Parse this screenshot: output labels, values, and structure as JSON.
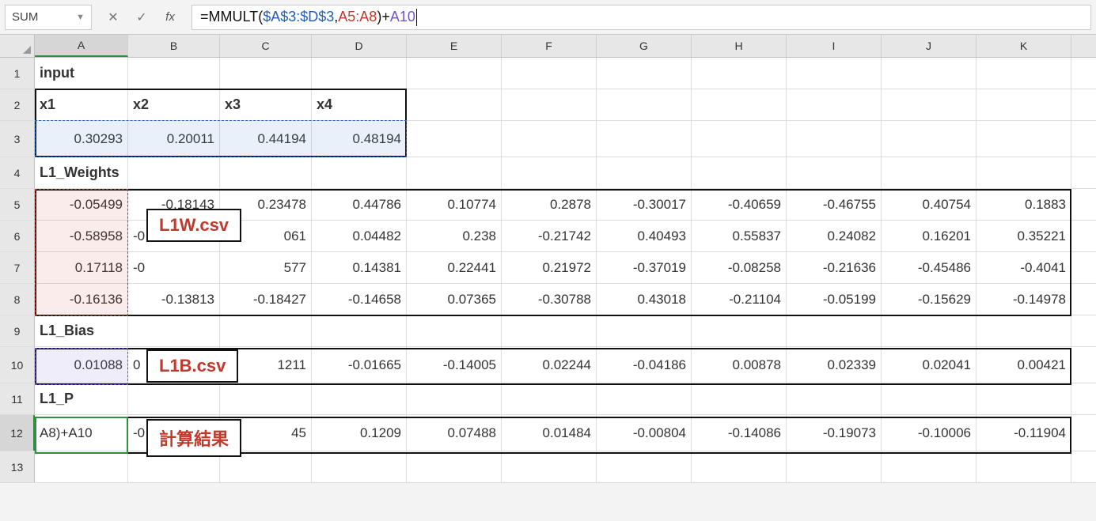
{
  "name_box": "SUM",
  "formula": {
    "prefix": "=",
    "func": "MMULT",
    "open": "(",
    "arg1": "$A$3:$D$3",
    "sep": ",",
    "arg2": "A5:A8",
    "close": ")",
    "plus": "+",
    "arg3": "A10"
  },
  "columns": [
    "A",
    "B",
    "C",
    "D",
    "E",
    "F",
    "G",
    "H",
    "I",
    "J",
    "K"
  ],
  "row_labels": [
    "1",
    "2",
    "3",
    "4",
    "5",
    "6",
    "7",
    "8",
    "9",
    "10",
    "11",
    "12",
    "13"
  ],
  "labels": {
    "input": "input",
    "x1": "x1",
    "x2": "x2",
    "x3": "x3",
    "x4": "x4",
    "l1w": "L1_Weights",
    "l1b": "L1_Bias",
    "l1p": "L1_P"
  },
  "row3": [
    "0.30293",
    "0.20011",
    "0.44194",
    "0.48194"
  ],
  "row5": [
    "-0.05499",
    "-0.18143",
    "0.23478",
    "0.44786",
    "0.10774",
    "0.2878",
    "-0.30017",
    "-0.40659",
    "-0.46755",
    "0.40754",
    "0.1883"
  ],
  "row6": [
    "-0.58958",
    "-0",
    "",
    "061",
    "0.04482",
    "0.238",
    "-0.21742",
    "0.40493",
    "0.55837",
    "0.24082",
    "0.16201",
    "0.35221"
  ],
  "row7": [
    "0.17118",
    "-0",
    "",
    "577",
    "0.14381",
    "0.22441",
    "0.21972",
    "-0.37019",
    "-0.08258",
    "-0.21636",
    "-0.45486",
    "-0.4041"
  ],
  "row8": [
    "-0.16136",
    "-0.13813",
    "-0.18427",
    "-0.14658",
    "0.07365",
    "-0.30788",
    "0.43018",
    "-0.21104",
    "-0.05199",
    "-0.15629",
    "-0.14978"
  ],
  "row10": [
    "0.01088",
    "0",
    "",
    "1211",
    "-0.01665",
    "-0.14005",
    "0.02244",
    "-0.04186",
    "0.00878",
    "0.02339",
    "0.02041",
    "0.00421"
  ],
  "row12": [
    "A8)+A10",
    "-0",
    "",
    "45",
    "0.1209",
    "0.07488",
    "0.01484",
    "-0.00804",
    "-0.14086",
    "-0.19073",
    "-0.10006",
    "-0.11904"
  ],
  "callouts": {
    "l1w": "L1W.csv",
    "l1b": "L1B.csv",
    "result": "計算結果"
  }
}
